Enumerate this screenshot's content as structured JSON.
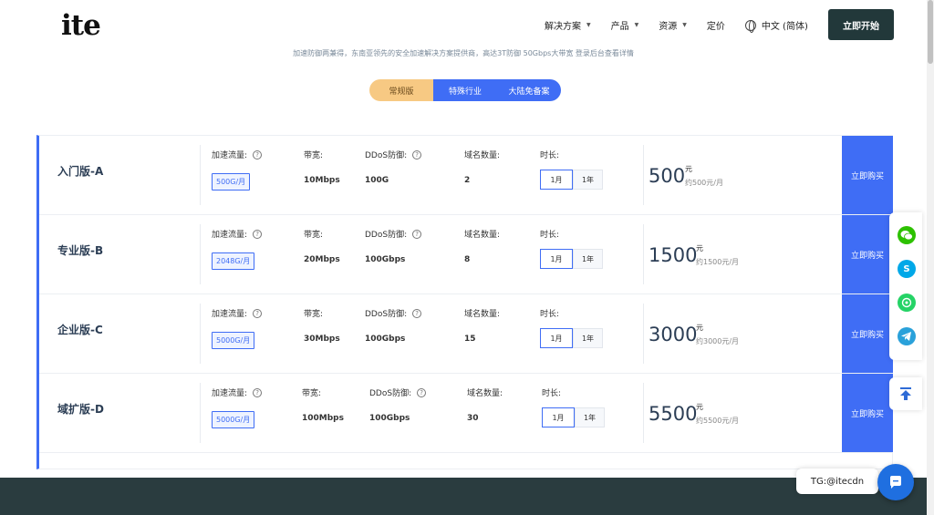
{
  "brand": {
    "logo": "ite"
  },
  "nav": {
    "items": [
      "解决方案",
      "产品",
      "资源",
      "定价"
    ],
    "language": "中文 (简体)",
    "cta": "立即开始"
  },
  "tagline": "加速防御两兼得，东南亚领先的安全加速解决方案提供商，高达3T防御 50Gbps大带宽 登录后台查看详情",
  "tabs": [
    "常规版",
    "特殊行业",
    "大陆免备案"
  ],
  "labels": {
    "traffic": "加速流量:",
    "bandwidth": "带宽:",
    "ddos": "DDoS防御:",
    "domains": "域名数量:",
    "duration": "时长:",
    "currency": "元",
    "month": "1月",
    "year": "1年",
    "buy": "立即购买",
    "help": "?"
  },
  "plans": [
    {
      "name": "入门版-A",
      "traffic": "500G/月",
      "bandwidth": "10Mbps",
      "ddos": "100G",
      "domains": "2",
      "price": "500",
      "approx": "约500元/月"
    },
    {
      "name": "专业版-B",
      "traffic": "2048G/月",
      "bandwidth": "20Mbps",
      "ddos": "100Gbps",
      "domains": "8",
      "price": "1500",
      "approx": "约1500元/月"
    },
    {
      "name": "企业版-C",
      "traffic": "5000G/月",
      "bandwidth": "30Mbps",
      "ddos": "100Gbps",
      "domains": "15",
      "price": "3000",
      "approx": "约3000元/月"
    },
    {
      "name": "域扩版-D",
      "traffic": "5000G/月",
      "bandwidth": "100Mbps",
      "ddos": "100Gbps",
      "domains": "30",
      "price": "5500",
      "approx": "约5500元/月"
    }
  ],
  "contact": {
    "tg": "TG:@itecdn"
  },
  "colors": {
    "accent": "#3f6df5",
    "active_tab": "#f7c983",
    "dark": "#22383a"
  },
  "icons": [
    "wechat-icon",
    "skype-icon",
    "whatsapp-icon",
    "telegram-icon",
    "back-to-top-icon",
    "chat-icon"
  ]
}
